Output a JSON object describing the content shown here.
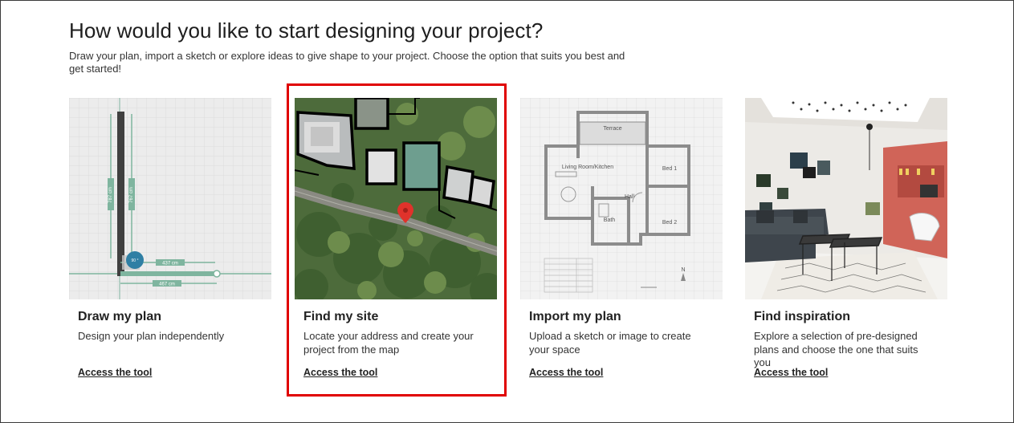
{
  "header": {
    "title": "How would you like to start designing your project?",
    "subtitle": "Draw your plan, import a sketch or explore ideas to give shape to your project. Choose the option that suits you best and get started!"
  },
  "cards": [
    {
      "title": "Draw my plan",
      "description": "Design your plan independently",
      "link": "Access the tool",
      "image": {
        "labels": [
          "787 cm",
          "767 cm",
          "437 cm",
          "467 cm",
          "90 °"
        ]
      }
    },
    {
      "title": "Find my site",
      "description": "Locate your address and create your project from the map",
      "link": "Access the tool",
      "highlighted": true
    },
    {
      "title": "Import my plan",
      "description": "Upload a sketch or image to create your space",
      "link": "Access the tool",
      "image": {
        "rooms": [
          "Terrace",
          "Living Room/Kitchen",
          "Bed 1",
          "Hall",
          "Bath",
          "Bed 2"
        ],
        "north": "N"
      }
    },
    {
      "title": "Find inspiration",
      "description": "Explore a selection of pre-designed plans and choose the one that suits you",
      "link": "Access the tool"
    }
  ],
  "colors": {
    "highlight": "#e00000",
    "measure_green": "#7fb59f",
    "dial_blue": "#2f7fa4"
  }
}
